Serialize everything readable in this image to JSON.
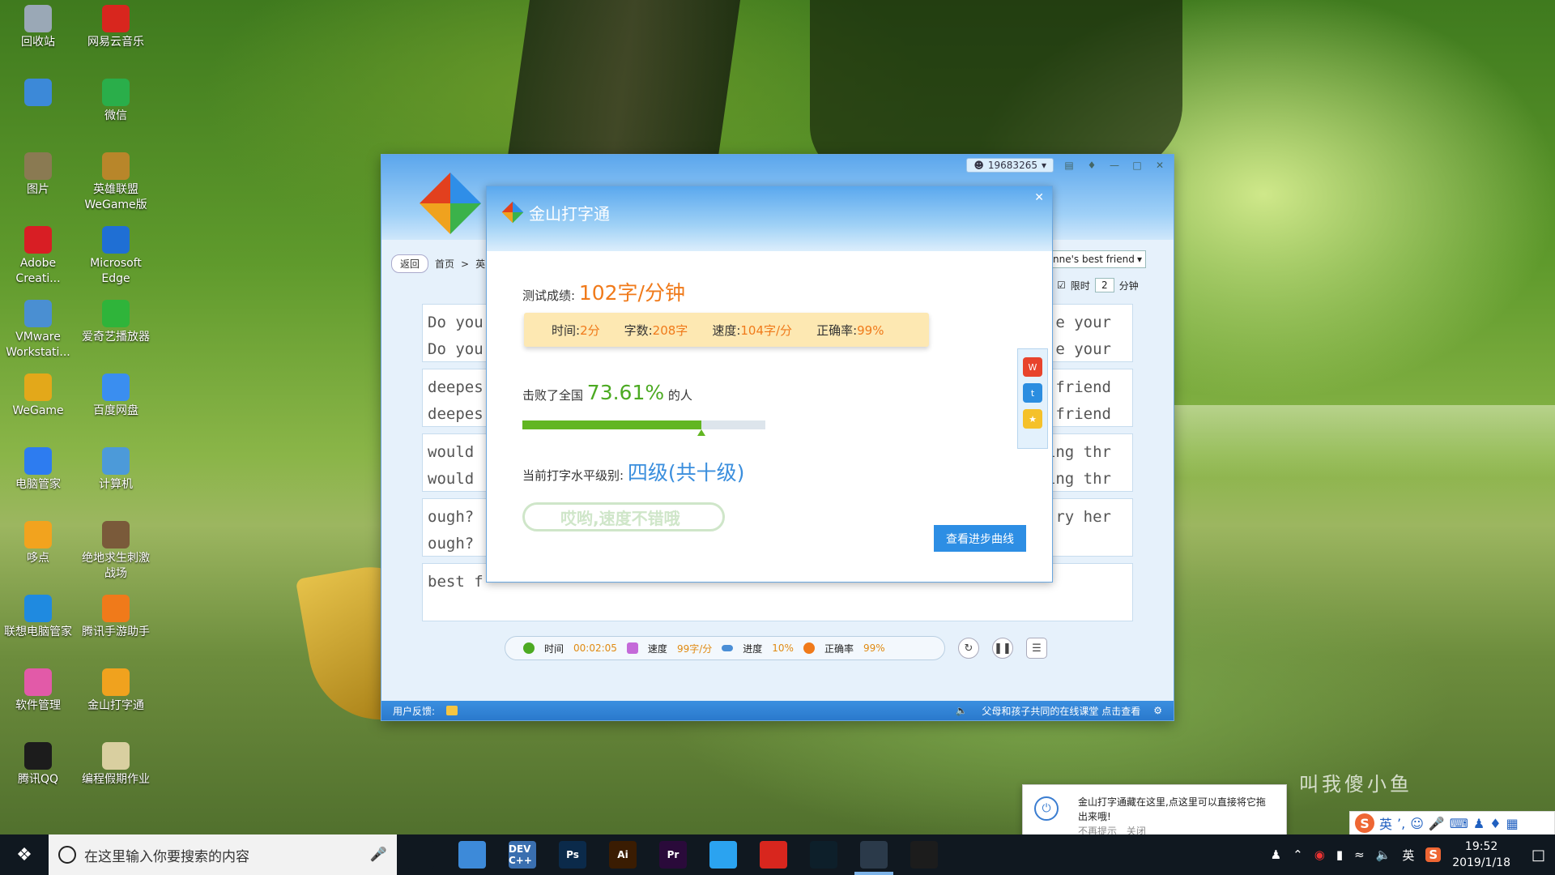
{
  "desktop_icons": [
    {
      "label": "回收站",
      "icon": "recycle-bin-icon",
      "color": "#9aa8b6"
    },
    {
      "label": "网易云音乐",
      "icon": "netease-music-icon",
      "color": "#d8261e"
    },
    {
      "label": "",
      "icon": "monitor-icon",
      "color": "#3c89d8"
    },
    {
      "label": "微信",
      "icon": "wechat-icon",
      "color": "#2aae4a"
    },
    {
      "label": "图片",
      "icon": "pictures-icon",
      "color": "#8a7a52"
    },
    {
      "label": "英雄联盟WeGame版",
      "icon": "lol-icon",
      "color": "#b8862a"
    },
    {
      "label": "Adobe Creati...",
      "icon": "adobe-cc-icon",
      "color": "#d81e24"
    },
    {
      "label": "Microsoft Edge",
      "icon": "edge-icon",
      "color": "#1f6fd4"
    },
    {
      "label": "VMware Workstati...",
      "icon": "vmware-icon",
      "color": "#4a8fd2"
    },
    {
      "label": "爱奇艺播放器",
      "icon": "iqiyi-icon",
      "color": "#2fb43a"
    },
    {
      "label": "WeGame",
      "icon": "wegame-icon",
      "color": "#e3a81a"
    },
    {
      "label": "百度网盘",
      "icon": "baidu-netdisk-icon",
      "color": "#3a8ef0"
    },
    {
      "label": "电脑管家",
      "icon": "pc-manager-icon",
      "color": "#2d7cf0"
    },
    {
      "label": "计算机",
      "icon": "computer-icon",
      "color": "#4c9ad9"
    },
    {
      "label": "哆点",
      "icon": "duodian-icon",
      "color": "#f2a31e"
    },
    {
      "label": "绝地求生刺激战场",
      "icon": "pubg-icon",
      "color": "#7a5a3a"
    },
    {
      "label": "联想电脑管家",
      "icon": "lenovo-manager-icon",
      "color": "#1f8ae0"
    },
    {
      "label": "腾讯手游助手",
      "icon": "tencent-mobile-icon",
      "color": "#f07a1a"
    },
    {
      "label": "软件管理",
      "icon": "software-manager-icon",
      "color": "#e25aa8"
    },
    {
      "label": "金山打字通",
      "icon": "typing-icon",
      "color": "#f0a21e"
    },
    {
      "label": "腾讯QQ",
      "icon": "qq-icon",
      "color": "#1c1c1c"
    },
    {
      "label": "编程假期作业",
      "icon": "folder-icon",
      "color": "#d9cfa0"
    }
  ],
  "app": {
    "partial_title": "金山打字通",
    "user": "19683265",
    "nav": {
      "back": "返回",
      "home": "首页",
      "sep": ">",
      "crumb": "英"
    },
    "dropdown": "nne's best friend",
    "limit_label": "限时",
    "limit_value": "2",
    "limit_unit": "分钟",
    "lines": [
      {
        "left1": "Do you",
        "left2": "Do you",
        "right1": "e your",
        "right2": "e your"
      },
      {
        "left1": "deepes",
        "left2": "deepes",
        "right1": "friend",
        "right2": "friend"
      },
      {
        "left1": "would",
        "left2": "would",
        "right1": "ing thr",
        "right2": "ing thr"
      },
      {
        "left1": "ough?",
        "left2": "ough?",
        "right1": "ry her",
        "right2": ""
      },
      {
        "left1": "best f",
        "left2": "",
        "right1": "",
        "right2": ""
      }
    ],
    "status": {
      "time_label": "时间",
      "time_value": "00:02:05",
      "speed_label": "速度",
      "speed_value": "99字/分",
      "progress_label": "进度",
      "progress_value": "10%",
      "accuracy_label": "正确率",
      "accuracy_value": "99%"
    },
    "footer": {
      "feedback": "用户反馈:",
      "ad": "父母和孩子共同的在线课堂 点击查看"
    }
  },
  "dialog": {
    "title": "金山打字通",
    "score_label": "测试成绩:",
    "score_value": "102字/分钟",
    "detail": {
      "time_label": "时间:",
      "time_value": "2分",
      "count_label": "字数:",
      "count_value": "208字",
      "speed_label": "速度:",
      "speed_value": "104字/分",
      "accuracy_label": "正确率:",
      "accuracy_value": "99%"
    },
    "beat_prefix": "击败了全国",
    "beat_value": "73.61%",
    "beat_suffix": "的人",
    "beat_fraction": 0.7361,
    "level_label": "当前打字水平级别:",
    "level_value": "四级(共十级)",
    "stamp": "哎哟,速度不错哦",
    "progress_button": "查看进步曲线"
  },
  "notification": {
    "text": "金山打字通藏在这里,点这里可以直接将它拖出来哦!",
    "no_remind": "不再提示",
    "close": "关闭"
  },
  "watermark": "叫我傻小鱼",
  "ime": {
    "lang": "英"
  },
  "taskbar": {
    "search_placeholder": "在这里输入你要搜索的内容",
    "apps": [
      {
        "label": "",
        "icon": "task-view-icon",
        "color": "#101820"
      },
      {
        "label": "",
        "icon": "computer-icon",
        "color": "#3d8ad9"
      },
      {
        "label": "DEV C++",
        "icon": "devcpp-icon",
        "color": "#3a6fb0"
      },
      {
        "label": "Ps",
        "icon": "photoshop-icon",
        "color": "#0b2a4a"
      },
      {
        "label": "Ai",
        "icon": "illustrator-icon",
        "color": "#3a1c02"
      },
      {
        "label": "Pr",
        "icon": "premiere-icon",
        "color": "#2a0a3a"
      },
      {
        "label": "",
        "icon": "qq-browser-icon",
        "color": "#2ba3f0"
      },
      {
        "label": "",
        "icon": "netease-music-icon",
        "color": "#d8261e"
      },
      {
        "label": "",
        "icon": "lol-icon",
        "color": "#0d1f2a"
      },
      {
        "label": "",
        "icon": "typing-icon",
        "color": "#2b3a4a"
      },
      {
        "label": "",
        "icon": "picasa-icon",
        "color": "#1c1c1c"
      }
    ],
    "tray_lang": "英",
    "time": "19:52",
    "date": "2019/1/18"
  }
}
